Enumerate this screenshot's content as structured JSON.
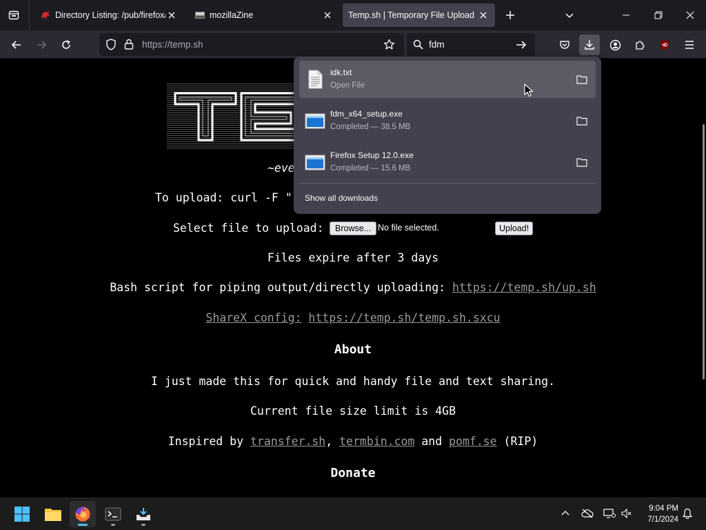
{
  "tabs": [
    {
      "title": "Directory Listing: /pub/firefox/c",
      "favicon": "mozilla-dino-icon",
      "active": false
    },
    {
      "title": "mozillaZine",
      "favicon": "mozillazine-icon",
      "active": false
    },
    {
      "title": "Temp.sh | Temporary File Upload",
      "favicon": "",
      "active": true
    }
  ],
  "navbar": {
    "url": "https://temp.sh",
    "search_value": "fdm"
  },
  "page": {
    "tagline": "~eve",
    "upload_cmd": "To upload: curl -F \"",
    "select_label": "Select file to upload:",
    "browse_label": "Browse...",
    "no_file": "No file selected.",
    "upload_label": "Upload!",
    "expire": "Files expire after 3 days",
    "bash_text": "Bash script for piping output/directly uploading: ",
    "bash_link": "https://temp.sh/up.sh",
    "sharex_label": "ShareX config:",
    "sharex_link": "https://temp.sh/temp.sh.sxcu",
    "about_heading": "About",
    "about_text": "I just made this for quick and handy file and text sharing.",
    "size_limit": "Current file size limit is 4GB",
    "inspired_prefix": "Inspired by ",
    "inspired_link1": "transfer.sh",
    "inspired_comma": ", ",
    "inspired_link2": "termbin.com",
    "inspired_and": " and ",
    "inspired_link3": "pomf.se",
    "inspired_suffix": " (RIP)",
    "donate_heading": "Donate"
  },
  "downloads": {
    "items": [
      {
        "name": "idk.txt",
        "status": "Open File",
        "icon": "text-file-icon"
      },
      {
        "name": "fdm_x64_setup.exe",
        "status": "Completed — 38.5 MB",
        "icon": "exe-file-icon"
      },
      {
        "name": "Firefox Setup 12.0.exe",
        "status": "Completed — 15.6 MB",
        "icon": "exe-file-icon"
      }
    ],
    "show_all": "Show all downloads"
  },
  "taskbar": {
    "time": "9:04 PM",
    "date": "7/1/2024",
    "apps": [
      "start-icon",
      "file-explorer-icon",
      "firefox-icon",
      "terminal-icon",
      "inbox-app-icon"
    ]
  },
  "colors": {
    "accent": "#4cc2ff",
    "tab_active": "#42414d",
    "panel_bg": "#42414d"
  }
}
